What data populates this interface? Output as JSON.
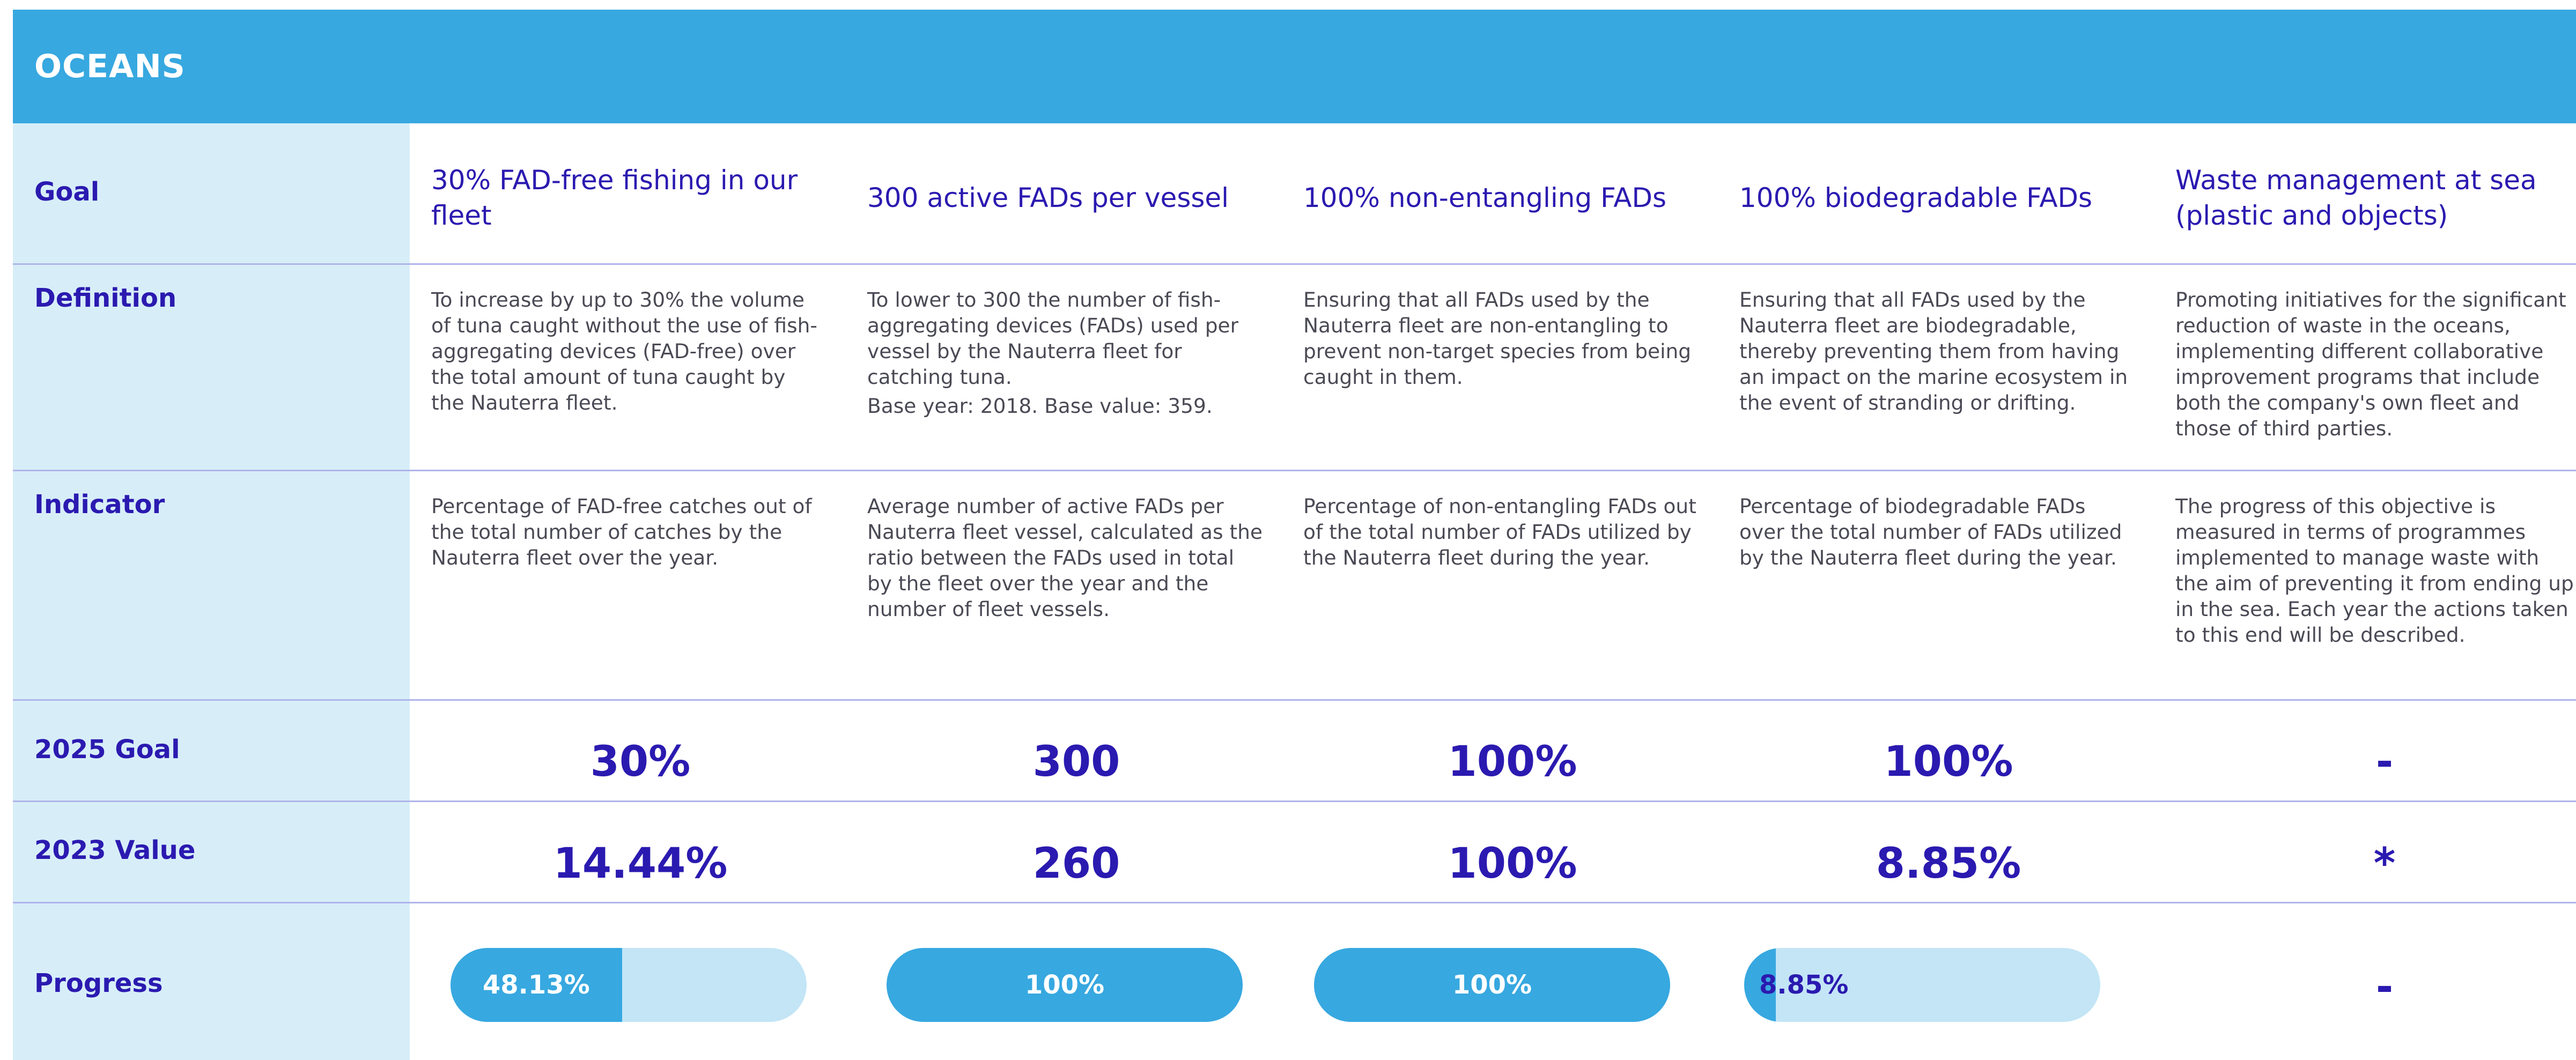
{
  "header": {
    "title": "OCEANS"
  },
  "rows": {
    "goal": "Goal",
    "definition": "Definition",
    "indicator": "Indicator",
    "goal_2025": "2025 Goal",
    "value_2023": "2023 Value",
    "progress": "Progress"
  },
  "columns": [
    {
      "goal": "30% FAD-free fishing in our fleet",
      "definition": "To increase by up to 30% the volume of tuna caught without the use of fish-aggregating devices (FAD-free) over the total amount of tuna caught by the Nauterra fleet.",
      "definition_note": "",
      "indicator": "Percentage of FAD-free catches out of the total number of catches by the Nauterra fleet over the year.",
      "goal_2025": "30%",
      "value_2023": "14.44%",
      "progress_label": "48.13%",
      "progress_fraction": 0.4813
    },
    {
      "goal": "300 active FADs per vessel",
      "definition": "To lower to 300 the number of fish-aggregating devices (FADs) used per vessel by the Nauterra fleet for catching tuna.",
      "definition_note": "Base year: 2018. Base value: 359.",
      "indicator": "Average number of active FADs per Nauterra fleet vessel, calculated as the ratio between the FADs used in total by the fleet over the year and the number of fleet vessels.",
      "goal_2025": "300",
      "value_2023": "260",
      "progress_label": "100%",
      "progress_fraction": 1.0
    },
    {
      "goal": "100% non-entangling FADs",
      "definition": "Ensuring that all FADs used by the Nauterra fleet are non-entangling to prevent non-target species from being caught in them.",
      "definition_note": "",
      "indicator": "Percentage of non-entangling FADs out of the total number of FADs utilized by the Nauterra fleet during the year.",
      "goal_2025": "100%",
      "value_2023": "100%",
      "progress_label": "100%",
      "progress_fraction": 1.0
    },
    {
      "goal": "100% biodegradable FADs",
      "definition": "Ensuring that all FADs used by the Nauterra fleet are biodegradable, thereby preventing them from having an impact on the marine ecosystem in the event of stranding or drifting.",
      "definition_note": "",
      "indicator": "Percentage of biodegradable FADs over the total number of FADs utilized by the Nauterra fleet during the year.",
      "goal_2025": "100%",
      "value_2023": "8.85%",
      "progress_label": "8.85%",
      "progress_fraction": 0.0885
    },
    {
      "goal": "Waste management at sea (plastic and objects)",
      "definition": "Promoting initiatives for the significant reduction of waste in the oceans, implementing different collaborative improvement programs that include both the company's own fleet and those of third parties.",
      "definition_note": "",
      "indicator": "The progress of this objective is measured in terms of programmes implemented to manage waste with the aim of preventing it from ending up in the sea. Each year the actions taken to this end will be described.",
      "goal_2025": "-",
      "value_2023": "*",
      "progress_label": "-",
      "progress_fraction": null
    }
  ],
  "colors": {
    "header_bg": "#37a8e0",
    "label_bg": "#d7eef9",
    "accent_text": "#2b1ab0",
    "bar_fill": "#37a8e0",
    "bar_track": "#c3e5f6",
    "divider": "#b0b4ea"
  }
}
